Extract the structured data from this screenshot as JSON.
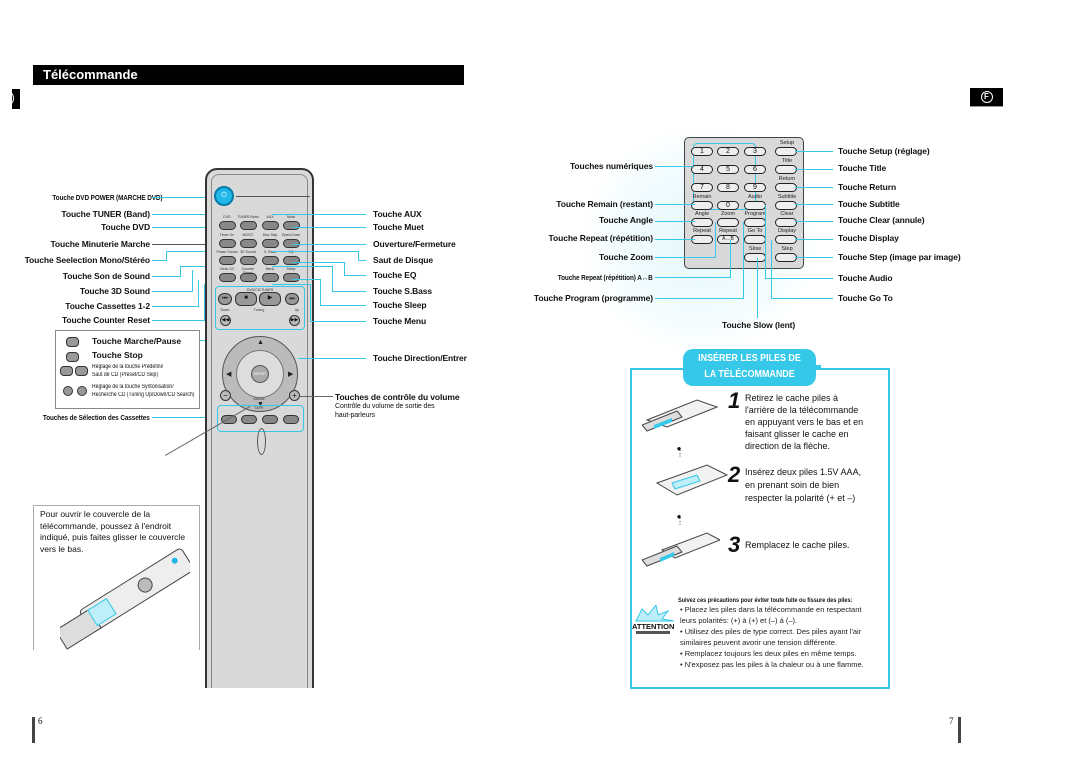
{
  "header": {
    "title": "Télécommande",
    "left_tab_glyph": ")",
    "lang_badge": "F"
  },
  "colors": {
    "accent": "#36c8e8",
    "header_bg": "#000000",
    "power_button": "#1fb6e8"
  },
  "remote_left_labels": [
    "Touche DVD POWER (MARCHE DVD)",
    "Touche TUNER (Band)",
    "Touche DVD",
    "Touche Minuterie Marche",
    "Touche Seelection Mono/Stéréo",
    "Touche Son de  Sound",
    "Touche 3D Sound",
    "Touche Cassettes 1-2",
    "Touche Counter Reset"
  ],
  "remote_right_labels": [
    "Touche AUX",
    "Touche Muet",
    "Ouverture/Fermeture",
    "Saut de Disque",
    "Touche EQ",
    "Touche S.Bass",
    "Touche Sleep",
    "Touche Menu",
    "Touche Direction/Entrer"
  ],
  "volume": {
    "title": "Touches de contrôle du volume",
    "desc_line1": "Contrôle du volume de sortie des",
    "desc_line2": "haut-parleurs"
  },
  "legend": {
    "items": [
      {
        "icon": "play-pause-icon",
        "text": "Touche Marche/Pause"
      },
      {
        "icon": "stop-icon",
        "text": "Touche Stop"
      },
      {
        "icon": "skip-icon",
        "text_line1": "Réglage de la touche Prédéfini/",
        "text_line2": "Saut de CD (Preset/CD Skip)"
      },
      {
        "icon": "search-icon",
        "text_line1": "Réglage de la touche Syntonisation/",
        "text_line2": "Recherche CD (Tuning Up/Down/CD Search)"
      }
    ],
    "cassette_select": "Touches de Sélection des Cassettes"
  },
  "remote_buttons": {
    "power": "⏻",
    "row1": [
      "DVD",
      "TUNER Band",
      "AUX",
      "Mute"
    ],
    "row2": [
      "Timer On",
      "MO/ST",
      "Disc Skip",
      "Open/Close"
    ],
    "row3": [
      "Power Sound",
      "3D Sound",
      "S. Bass",
      "EQ"
    ],
    "row4": [
      "Deck 1/2",
      "Counter Reset",
      "Menu",
      "Sleep"
    ],
    "transport_label": "DVD/CD/TUNER",
    "tuning_label": "Tuning",
    "down_label": "Down",
    "up_label": "Up",
    "enter_label": "ENTER",
    "volume_label": "Volume",
    "tape_label": "TAPE"
  },
  "cover": {
    "text": "Pour ouvrir le couvercle de la télécommande, poussez à l'endroit indiqué, puis faites glisser le couvercle vers le bas."
  },
  "keypad": {
    "numbers": [
      "1",
      "2",
      "3",
      "4",
      "5",
      "6",
      "7",
      "8",
      "9",
      "0"
    ],
    "button_labels": {
      "setup": "Setup",
      "title": "Title",
      "return": "Return",
      "remain": "Remain",
      "audio": "Audio",
      "subtitle": "Subtitle",
      "angle": "Angle",
      "zoom": "Zoom",
      "program": "Program",
      "clear": "Clear",
      "repeat": "Repeat",
      "repeat_ab": "Repeat",
      "repeat_ab_btn": "A↔B",
      "goto": "Go To",
      "display": "Display",
      "slow": "Slow",
      "step": "Step"
    },
    "left_labels": [
      "Touches numériques",
      "Touche Remain (restant)",
      "Touche Angle",
      "Touche Repeat (répétition)",
      "Touche Zoom",
      "Touche Repeat (répétition) A↔B",
      "Touche Program (programme)"
    ],
    "right_labels": [
      "Touche Setup (réglage)",
      "Touche Title",
      "Touche Return",
      "Touche Subtitle",
      "Touche Clear (annule)",
      "Touche Display",
      "Touche Step (image par image)",
      "Touche Audio",
      "Touche Go To"
    ],
    "bottom_label": "Touche Slow (lent)"
  },
  "battery": {
    "title_line1": "INSÉRER LES PILES DE",
    "title_line2": "LA TÉLÉCOMMANDE",
    "steps": [
      {
        "num": "1",
        "lines": [
          "Retirez le cache piles à",
          "l'arrière de la télécommande",
          "en appuyant vers le bas et en",
          "faisant glisser le cache  en",
          "direction de la flèche."
        ]
      },
      {
        "num": "2",
        "lines": [
          "Insérez deux piles 1.5V AAA,",
          "en prenant soin de bien",
          "respecter la polarité (+ et –)"
        ]
      },
      {
        "num": "3",
        "lines": [
          "Remplacez le cache piles."
        ]
      }
    ],
    "attention": {
      "badge": "ATTENTION",
      "title": "Suivez ces précautions pour éviter toute fuite ou fissure des piles:",
      "items": [
        "• Placez les piles dans la télécommande en respectant",
        "  leurs polarités: (+) à (+) et (–) à (–).",
        "• Utilisez des piles de type correct. Des piles ayant l'air",
        "  similaires peuvent avorir une tension différente.",
        "• Remplacez toujours les deux piles en même temps.",
        "• N'exposez pas les piles à la chaleur ou à une flamme."
      ]
    }
  },
  "pages": {
    "left": "6",
    "right": "7"
  }
}
